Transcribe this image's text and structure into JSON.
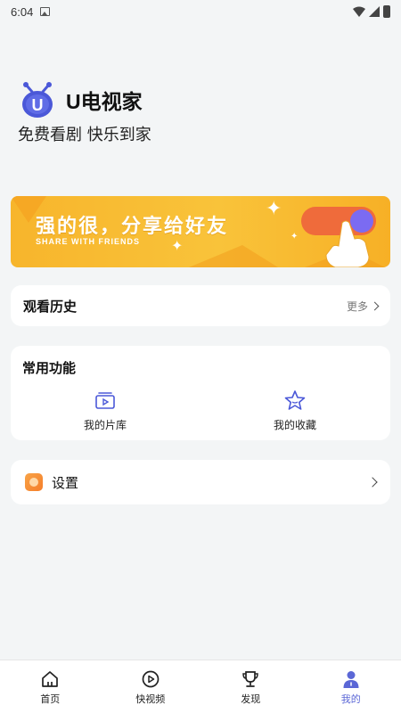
{
  "status_bar": {
    "time": "6:04"
  },
  "brand": {
    "name": "U电视家",
    "logo_letter": "U"
  },
  "slogan": "免费看剧 快乐到家",
  "banner": {
    "title": "强的很，分享给好友",
    "subtitle": "SHARE WITH FRIENDS"
  },
  "history": {
    "title": "观看历史",
    "more_label": "更多"
  },
  "functions": {
    "title": "常用功能",
    "items": [
      {
        "label": "我的片库",
        "icon": "video-library-icon"
      },
      {
        "label": "我的收藏",
        "icon": "star-icon"
      }
    ]
  },
  "settings": {
    "label": "设置"
  },
  "bottom_nav": {
    "items": [
      {
        "label": "首页",
        "icon": "home-icon"
      },
      {
        "label": "快视频",
        "icon": "play-circle-icon"
      },
      {
        "label": "发现",
        "icon": "trophy-icon"
      },
      {
        "label": "我的",
        "icon": "profile-icon"
      }
    ],
    "active_index": 3
  },
  "colors": {
    "accent": "#5b67d6",
    "banner_bg": "#f9c33a",
    "background": "#f3f5f6"
  }
}
